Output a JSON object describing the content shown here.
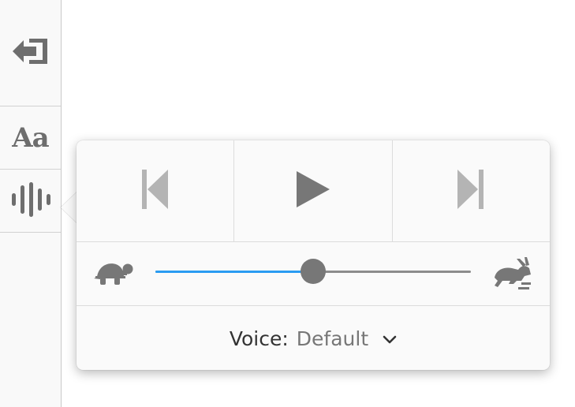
{
  "toolbar": {
    "exit_icon": "exit-reader-icon",
    "font_label": "Aa",
    "narrate_icon": "narrate-waveform-icon"
  },
  "narrate_popup": {
    "controls": {
      "back_icon": "skip-back-icon",
      "play_icon": "play-icon",
      "forward_icon": "skip-forward-icon"
    },
    "rate": {
      "slow_icon": "turtle-icon",
      "fast_icon": "rabbit-icon",
      "value": 0.5
    },
    "voice": {
      "label": "Voice:",
      "value": "Default",
      "chevron_icon": "chevron-down-icon"
    }
  },
  "colors": {
    "accent": "#2a9cf2",
    "icon_gray": "#777777",
    "disabled_gray": "#b4b4b4"
  }
}
